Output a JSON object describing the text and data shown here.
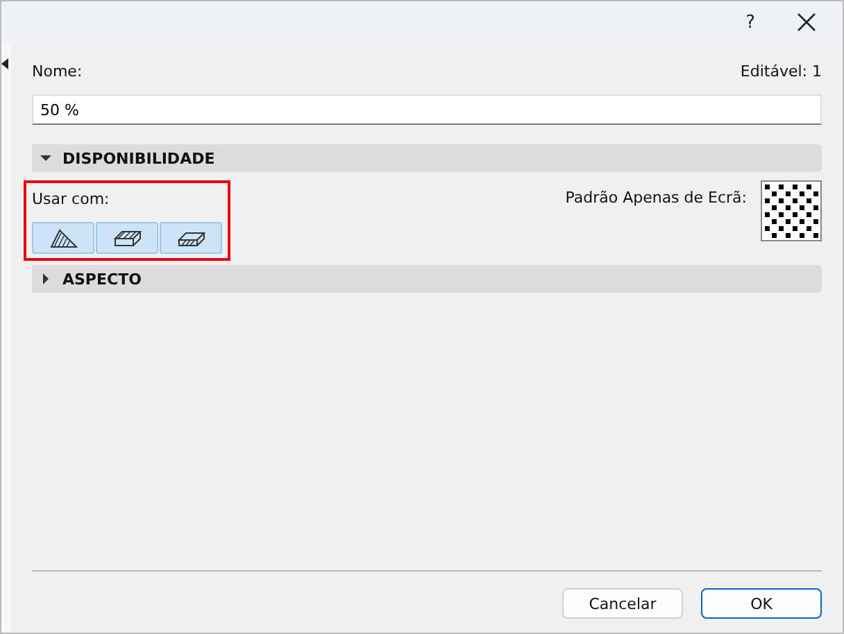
{
  "title_bar": {
    "help": "?"
  },
  "name_field": {
    "label": "Nome:",
    "editable": "Editável: 1",
    "value": "50 %"
  },
  "sections": [
    {
      "title": "DISPONIBILIDADE",
      "expanded": true,
      "usar_com": {
        "label": "Usar com:",
        "highlighted": true,
        "tools": [
          {
            "kind": "slab",
            "selected": true
          },
          {
            "kind": "box",
            "selected": true
          },
          {
            "kind": "flat",
            "selected": true
          }
        ]
      },
      "pattern_label": "Padrão Apenas de Ecrã:"
    },
    {
      "title": "ASPECTO",
      "expanded": false
    }
  ],
  "buttons": [
    {
      "label": "Cancelar",
      "default": false
    },
    {
      "label": "OK",
      "default": true
    }
  ]
}
